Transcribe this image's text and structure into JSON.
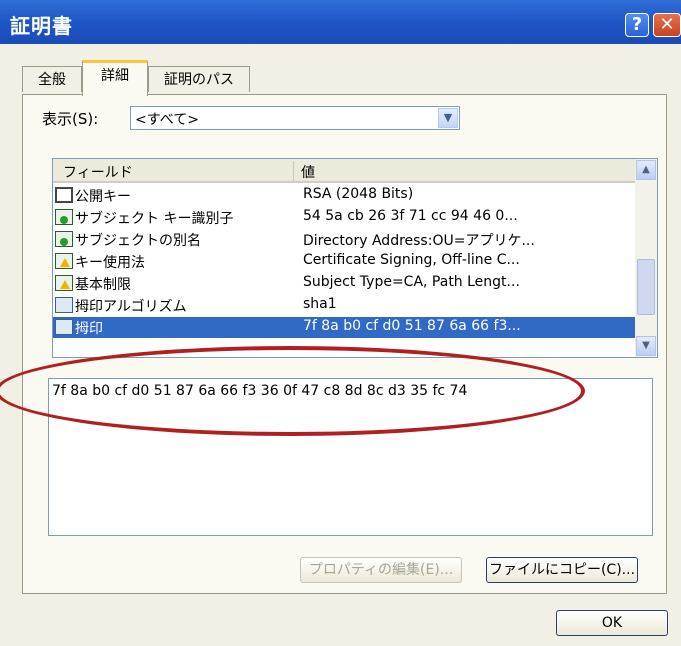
{
  "window": {
    "title": "証明書",
    "help_glyph": "?",
    "close_glyph": "✕"
  },
  "tabs": [
    {
      "label": "全般"
    },
    {
      "label": "詳細"
    },
    {
      "label": "証明のパス"
    }
  ],
  "show": {
    "label": "表示(S):",
    "value": "<すべて>"
  },
  "fields_list": {
    "columns": {
      "field": "フィールド",
      "value": "値"
    },
    "rows": [
      {
        "field": "公開キー",
        "value": "RSA (2048 Bits)",
        "icon": "key-icon"
      },
      {
        "field": "サブジェクト キー識別子",
        "value": "54 5a cb 26 3f 71 cc 94 46 0...",
        "icon": "extension-icon"
      },
      {
        "field": "サブジェクトの別名",
        "value": "Directory Address:OU=アプリケ...",
        "icon": "extension-icon"
      },
      {
        "field": "キー使用法",
        "value": "Certificate Signing, Off-line C...",
        "icon": "critical-extension-icon"
      },
      {
        "field": "基本制限",
        "value": "Subject Type=CA, Path Lengt...",
        "icon": "critical-extension-icon"
      },
      {
        "field": "拇印アルゴリズム",
        "value": "sha1",
        "icon": "property-icon"
      },
      {
        "field": "拇印",
        "value": "7f 8a b0 cf d0 51 87 6a 66 f3...",
        "icon": "property-icon",
        "selected": true
      }
    ]
  },
  "detail_text": "7f 8a b0 cf d0 51 87 6a 66 f3 36 0f 47 c8 8d 8c d3 35 fc 74",
  "buttons": {
    "edit_properties": "プロパティの編集(E)...",
    "copy_to_file": "ファイルにコピー(C)...",
    "ok": "OK"
  },
  "colors": {
    "selection": "#316ac5",
    "annotation": "#b02020",
    "titlebar": "#1f56c6"
  }
}
